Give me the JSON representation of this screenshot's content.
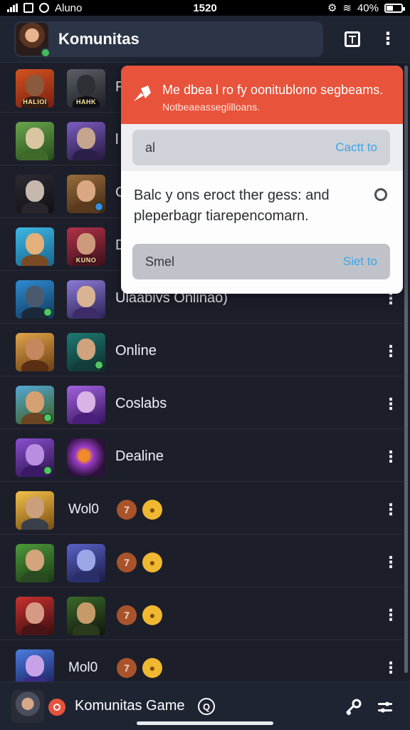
{
  "status_bar": {
    "carrier": "Aluno",
    "time": "1520",
    "battery": "40%"
  },
  "header": {
    "title": "Komunitas",
    "icons": [
      "avatar",
      "book-icon",
      "more-vert-icon"
    ]
  },
  "dialog": {
    "title": "Me dbea l ro fy oonitublono segbeams.",
    "subtitle": "Notbeaeasseglilloans.",
    "field1": {
      "value": "al",
      "action": "Cactt to"
    },
    "body": "Balc y ons eroct ther gess: and pleperbagr tiarepencomarn.",
    "field2": {
      "value": "Smel",
      "action": "Siet to"
    },
    "colors": {
      "header": "#e8533b",
      "link": "#3aa7ea"
    }
  },
  "list": [
    {
      "label": "F",
      "thumb_a": "HALIOI",
      "thumb_b": "HAHK"
    },
    {
      "label": "l",
      "thumb_a": "",
      "thumb_b": ""
    },
    {
      "label": "C",
      "thumb_a": "",
      "thumb_b": ""
    },
    {
      "label": "D",
      "thumb_a": "",
      "thumb_b": "KUNO"
    },
    {
      "label": "Ulaabivs Onlinao)",
      "thumb_a": "",
      "thumb_b": ""
    },
    {
      "label": "Online",
      "thumb_a": "",
      "thumb_b": ""
    },
    {
      "label": "Coslabs",
      "thumb_a": "",
      "thumb_b": ""
    },
    {
      "label": "Dealine",
      "thumb_a": "",
      "thumb_b": ""
    },
    {
      "label": "Wol0",
      "thumb_a": "",
      "thumb_b": ""
    },
    {
      "label": "",
      "thumb_a": "",
      "thumb_b": ""
    },
    {
      "label": "",
      "thumb_a": "",
      "thumb_b": ""
    },
    {
      "label": "Mol0",
      "thumb_a": "",
      "thumb_b": ""
    }
  ],
  "bottom_bar": {
    "title": "Komunitas Game",
    "title_badge": "Q"
  }
}
